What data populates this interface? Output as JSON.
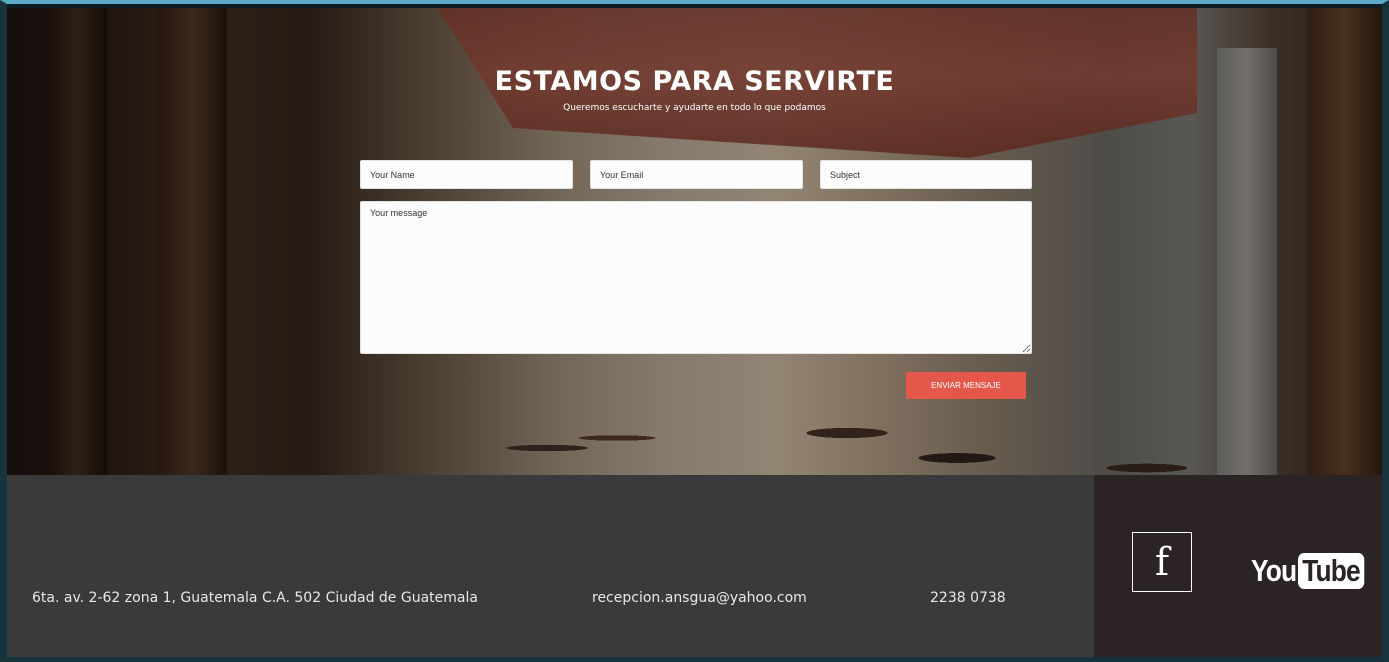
{
  "contact": {
    "heading": "ESTAMOS PARA SERVIRTE",
    "subheading": "Queremos escucharte y ayudarte en todo lo que podamos",
    "name_placeholder": "Your Name",
    "email_placeholder": "Your Email",
    "subject_placeholder": "Subject",
    "message_placeholder": "Your message",
    "submit_label": "ENVIAR MENSAJE"
  },
  "footer": {
    "address": "6ta. av. 2-62 zona 1, Guatemala C.A. 502 Ciudad de Guatemala",
    "email": "recepcion.ansgua@yahoo.com",
    "phone": "2238 0738",
    "facebook_icon": "facebook-icon",
    "youtube_you": "You",
    "youtube_tube": "Tube"
  },
  "colors": {
    "accent_button": "#e4584c",
    "footer_bg": "#3a3a3a",
    "social_bg": "#2b2324",
    "top_border": "#5aa9c9"
  }
}
